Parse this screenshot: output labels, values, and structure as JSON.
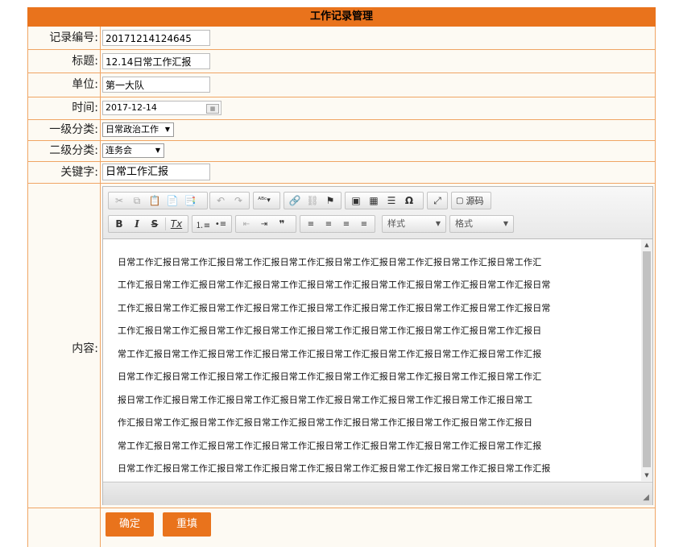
{
  "title": "工作记录管理",
  "fields": {
    "record_no": {
      "label": "记录编号:",
      "value": "20171214124645"
    },
    "subject": {
      "label": "标题:",
      "value": "12.14日常工作汇报"
    },
    "unit": {
      "label": "单位:",
      "value": "第一大队"
    },
    "time": {
      "label": "时间:",
      "value": "2017-12-14"
    },
    "category1": {
      "label": "一级分类:",
      "value": "日常政治工作"
    },
    "category2": {
      "label": "二级分类:",
      "value": "连务会"
    },
    "keyword": {
      "label": "关键字:",
      "value": "日常工作汇报"
    },
    "content": {
      "label": "内容:"
    }
  },
  "editor": {
    "source_label": "源码",
    "style_label": "样式",
    "format_label": "格式",
    "lines": [
      "日常工作汇报日常工作汇报日常工作汇报日常工作汇报日常工作汇报日常工作汇报日常工作汇报日常工作汇",
      "工作汇报日常工作汇报日常工作汇报日常工作汇报日常工作汇报日常工作汇报日常工作汇报日常工作汇报日常",
      "工作汇报日常工作汇报日常工作汇报日常工作汇报日常工作汇报日常工作汇报日常工作汇报日常工作汇报日常",
      "工作汇报日常工作汇报日常工作汇报日常工作汇报日常工作汇报日常工作汇报日常工作汇报日常工作汇报日",
      "常工作汇报日常工作汇报日常工作汇报日常工作汇报日常工作汇报日常工作汇报日常工作汇报日常工作汇报",
      "日常工作汇报日常工作汇报日常工作汇报日常工作汇报日常工作汇报日常工作汇报日常工作汇报日常工作汇",
      "报日常工作汇报日常工作汇报日常工作汇报日常工作汇报日常工作汇报日常工作汇报日常工作汇报日常工",
      "作汇报日常工作汇报日常工作汇报日常工作汇报日常工作汇报日常工作汇报日常工作汇报日常工作汇报日",
      "常工作汇报日常工作汇报日常工作汇报日常工作汇报日常工作汇报日常工作汇报日常工作汇报日常工作汇报",
      "日常工作汇报日常工作汇报日常工作汇报日常工作汇报日常工作汇报日常工作汇报日常工作汇报日常工作汇报"
    ]
  },
  "buttons": {
    "confirm": "确定",
    "reset": "重填"
  },
  "colors": {
    "accent": "#e9731c",
    "border": "#f0a564",
    "row_bg": "#fdfaf3"
  }
}
